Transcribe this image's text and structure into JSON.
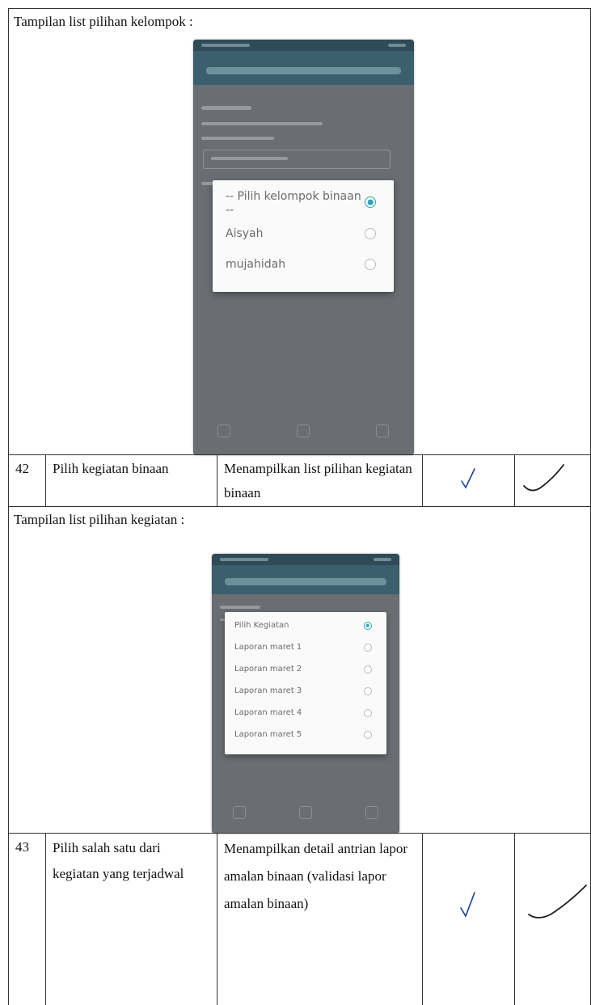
{
  "sections": [
    {
      "title": "Tampilan list pilihan kelompok :",
      "dialog_options": [
        {
          "label": "-- Pilih kelompok binaan --",
          "selected": true
        },
        {
          "label": "Aisyah",
          "selected": false
        },
        {
          "label": "mujahidah",
          "selected": false
        }
      ]
    },
    {
      "title": "Tampilan list pilihan kegiatan :",
      "dialog_options": [
        {
          "label": "Pilih Kegiatan",
          "selected": true
        },
        {
          "label": "Laporan maret 1",
          "selected": false
        },
        {
          "label": "Laporan maret 2",
          "selected": false
        },
        {
          "label": "Laporan maret 3",
          "selected": false
        },
        {
          "label": "Laporan maret 4",
          "selected": false
        },
        {
          "label": "Laporan maret 5",
          "selected": false
        }
      ]
    }
  ],
  "rows": [
    {
      "number": "42",
      "action": "Pilih kegiatan binaan",
      "expected": "Menampilkan list pilihan kegiatan binaan"
    },
    {
      "number": "43",
      "action": "Pilih salah satu dari kegiatan yang terjadwal",
      "expected": "Menampilkan detail antrian lapor amalan binaan (validasi lapor amalan binaan)"
    }
  ],
  "colors": {
    "radio_accent": "#2aa4b3",
    "check_ink": "#1a3d9e",
    "signature_ink": "#1c1c1c"
  },
  "icons": [
    "check-mark-icon",
    "signature-tick-icon",
    "radio-selected-icon",
    "radio-empty-icon"
  ]
}
